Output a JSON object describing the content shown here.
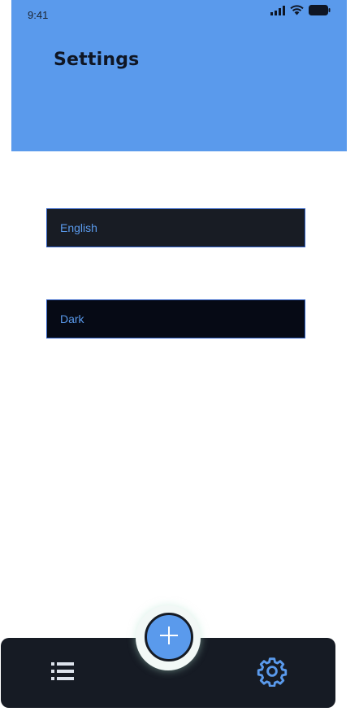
{
  "status_bar": {
    "time": "9:41",
    "icons": [
      "cellular-signal-icon",
      "wifi-icon",
      "battery-icon"
    ]
  },
  "header": {
    "title": "Settings"
  },
  "settings": {
    "language": {
      "value": "English"
    },
    "theme": {
      "value": "Dark"
    }
  },
  "bottom_nav": {
    "items": [
      {
        "icon": "list-icon"
      },
      {
        "icon": "add-icon"
      },
      {
        "icon": "gear-icon"
      }
    ]
  },
  "colors": {
    "accent": "#5a9aec",
    "nav_background": "#161b24",
    "field_border": "#2f5fc4"
  }
}
